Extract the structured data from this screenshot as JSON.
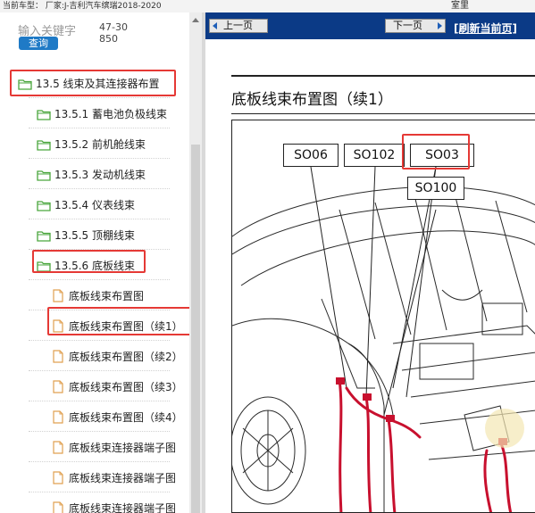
{
  "topbar": {
    "vehicle_label": "当前车型：",
    "vehicle_value": "厂家:J-吉利汽车缤瑞2018-2020",
    "right_text": "室里"
  },
  "search": {
    "keyword_label": "输入关键字",
    "keyword_value": "47-30850",
    "search_button": "查询"
  },
  "tree": [
    {
      "label": "13.5 线束及其连接器布置",
      "type": "folder"
    },
    {
      "label": "13.5.1 蓄电池负极线束",
      "type": "folder"
    },
    {
      "label": "13.5.2 前机舱线束",
      "type": "folder"
    },
    {
      "label": "13.5.3 发动机线束",
      "type": "folder"
    },
    {
      "label": "13.5.4 仪表线束",
      "type": "folder"
    },
    {
      "label": "13.5.5 顶棚线束",
      "type": "folder"
    },
    {
      "label": "13.5.6 底板线束",
      "type": "folder"
    },
    {
      "label": "底板线束布置图",
      "type": "page"
    },
    {
      "label": "底板线束布置图（续1）",
      "type": "page"
    },
    {
      "label": "底板线束布置图（续2）",
      "type": "page"
    },
    {
      "label": "底板线束布置图（续3）",
      "type": "page"
    },
    {
      "label": "底板线束布置图（续4）",
      "type": "page"
    },
    {
      "label": "底板线束连接器端子图",
      "type": "page"
    },
    {
      "label": "底板线束连接器端子图",
      "type": "page"
    },
    {
      "label": "底板线束连接器端子图",
      "type": "page"
    }
  ],
  "nav": {
    "prev": "上一页",
    "next": "下一页",
    "refresh": "[刷新当前页]"
  },
  "document": {
    "title": "底板线束布置图（续1）"
  },
  "diagram": {
    "callouts": [
      "SO06",
      "SO102",
      "SO03",
      "SO100"
    ]
  },
  "colors": {
    "nav_bg": "#0b3a86",
    "highlight": "#e53935",
    "search_button": "#1f7ac6",
    "harness": "#c8102e",
    "folder": "#4aa63d"
  }
}
